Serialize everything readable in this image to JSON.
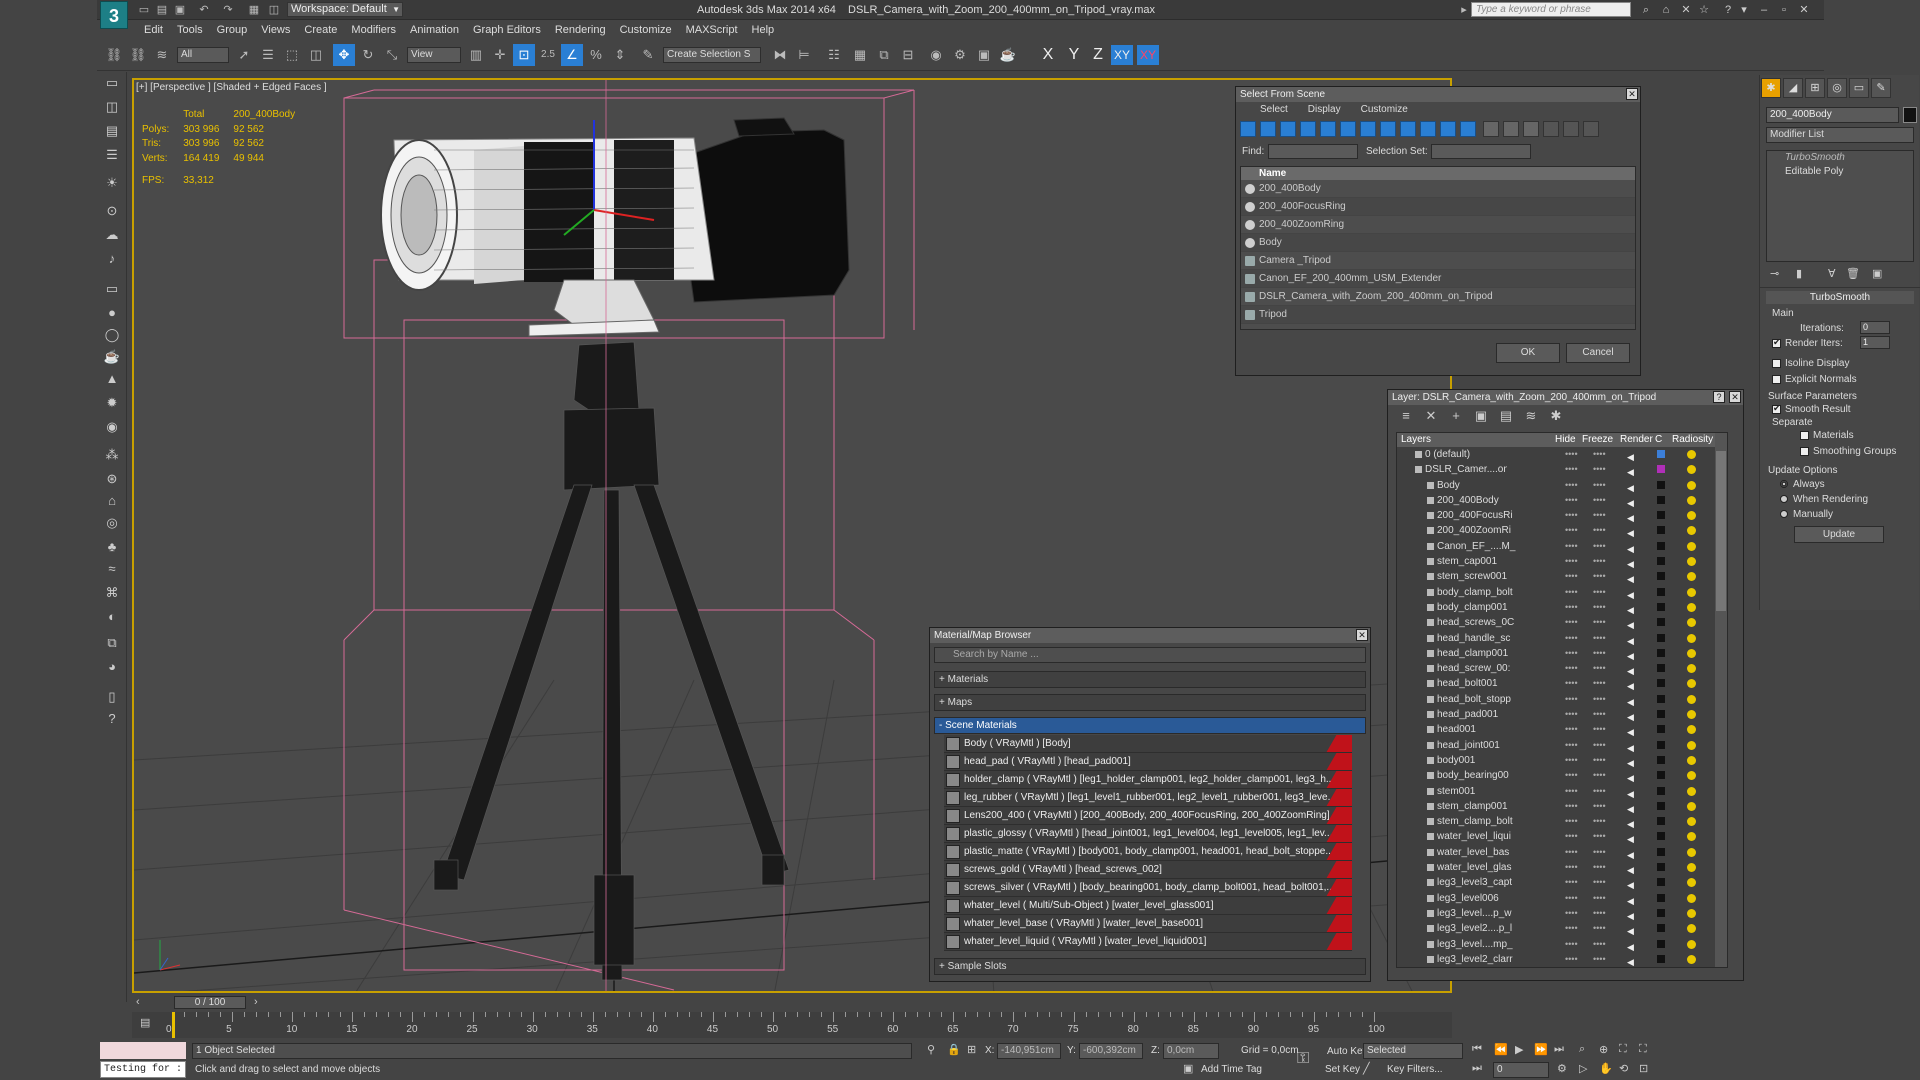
{
  "app": {
    "title": "Autodesk 3ds Max  2014 x64",
    "file": "DSLR_Camera_with_Zoom_200_400mm_on_Tripod_vray.max",
    "workspace": "Workspace: Default",
    "search_placeholder": "Type a keyword or phrase"
  },
  "menu": [
    "Edit",
    "Tools",
    "Group",
    "Views",
    "Create",
    "Modifiers",
    "Animation",
    "Graph Editors",
    "Rendering",
    "Customize",
    "MAXScript",
    "Help"
  ],
  "toolbar": {
    "filter": "All",
    "refcoord": "View",
    "snap_label": "2.5",
    "named_selection": "Create Selection S",
    "axis_x": "X",
    "axis_y": "Y",
    "axis_z": "Z",
    "axis_xy": "XY",
    "axis_xy2": "XY"
  },
  "viewport": {
    "label": "[+] [Perspective ] [Shaded + Edged Faces ]",
    "stats": {
      "total_label": "Total",
      "selected_label": "200_400Body",
      "rows": [
        {
          "label": "Polys:",
          "total": "303 996",
          "sel": "92 562"
        },
        {
          "label": "Tris:",
          "total": "303 996",
          "sel": "92 562"
        },
        {
          "label": "Verts:",
          "total": "164 419",
          "sel": "49 944"
        }
      ],
      "fps_label": "FPS:",
      "fps": "33,312"
    }
  },
  "select_from_scene": {
    "title": "Select From Scene",
    "menu": [
      "Select",
      "Display",
      "Customize"
    ],
    "find_label": "Find:",
    "selection_set_label": "Selection Set:",
    "name_header": "Name",
    "items": [
      {
        "name": "200_400Body",
        "group": false
      },
      {
        "name": "200_400FocusRing",
        "group": false
      },
      {
        "name": "200_400ZoomRing",
        "group": false
      },
      {
        "name": "Body",
        "group": false
      },
      {
        "name": "Camera _Tripod",
        "group": true
      },
      {
        "name": "Canon_EF_200_400mm_USM_Extender",
        "group": true
      },
      {
        "name": "DSLR_Camera_with_Zoom_200_400mm_on_Tripod",
        "group": true
      },
      {
        "name": "Tripod",
        "group": true
      }
    ],
    "ok": "OK",
    "cancel": "Cancel"
  },
  "material_browser": {
    "title": "Material/Map Browser",
    "search": "Search by Name ...",
    "sections": {
      "materials": "+ Materials",
      "maps": "+ Maps",
      "scene": "- Scene Materials",
      "samples": "+ Sample Slots"
    },
    "items": [
      "Body  ( VRayMtl ) [Body]",
      "head_pad  ( VRayMtl ) [head_pad001]",
      "holder_clamp  ( VRayMtl ) [leg1_holder_clamp001, leg2_holder_clamp001, leg3_h...",
      "leg_rubber  ( VRayMtl ) [leg1_level1_rubber001, leg2_level1_rubber001, leg3_leve...",
      "Lens200_400  ( VRayMtl ) [200_400Body, 200_400FocusRing, 200_400ZoomRing]",
      "plastic_glossy  ( VRayMtl ) [head_joint001, leg1_level004, leg1_level005, leg1_lev...",
      "plastic_matte  ( VRayMtl ) [body001, body_clamp001, head001, head_bolt_stoppe...",
      "screws_gold  ( VRayMtl ) [head_screws_002]",
      "screws_silver  ( VRayMtl ) [body_bearing001, body_clamp_bolt001, head_bolt001,...",
      "whater_level  ( Multi/Sub-Object ) [water_level_glass001]",
      "whater_level_base  ( VRayMtl ) [water_level_base001]",
      "whater_level_liquid  ( VRayMtl ) [water_level_liquid001]"
    ]
  },
  "layer_panel": {
    "title": "Layer: DSLR_Camera_with_Zoom_200_400mm_on_Tripod",
    "help": "?",
    "headers": {
      "layers": "Layers",
      "hide": "Hide",
      "freeze": "Freeze",
      "render": "Render",
      "c": "C",
      "radiosity": "Radiosity"
    },
    "rows": [
      {
        "name": "0 (default)",
        "indent": 1,
        "color": "#3c7fd8"
      },
      {
        "name": "DSLR_Camer....on_",
        "indent": 1,
        "color": "#b02fb8"
      },
      {
        "name": "Body",
        "indent": 2,
        "color": "#111111"
      },
      {
        "name": "200_400Body",
        "indent": 2,
        "color": "#111111"
      },
      {
        "name": "200_400FocusRi",
        "indent": 2,
        "color": "#111111"
      },
      {
        "name": "200_400ZoomRi",
        "indent": 2,
        "color": "#111111"
      },
      {
        "name": "Canon_EF_....M_",
        "indent": 2,
        "color": "#111111"
      },
      {
        "name": "stem_cap001",
        "indent": 2,
        "color": "#111111"
      },
      {
        "name": "stem_screw001",
        "indent": 2,
        "color": "#111111"
      },
      {
        "name": "body_clamp_bolt",
        "indent": 2,
        "color": "#111111"
      },
      {
        "name": "body_clamp001",
        "indent": 2,
        "color": "#111111"
      },
      {
        "name": "head_screws_0C",
        "indent": 2,
        "color": "#111111"
      },
      {
        "name": "head_handle_sc",
        "indent": 2,
        "color": "#111111"
      },
      {
        "name": "head_clamp001",
        "indent": 2,
        "color": "#111111"
      },
      {
        "name": "head_screw_00:",
        "indent": 2,
        "color": "#111111"
      },
      {
        "name": "head_bolt001",
        "indent": 2,
        "color": "#111111"
      },
      {
        "name": "head_bolt_stopp",
        "indent": 2,
        "color": "#111111"
      },
      {
        "name": "head_pad001",
        "indent": 2,
        "color": "#111111"
      },
      {
        "name": "head001",
        "indent": 2,
        "color": "#111111"
      },
      {
        "name": "head_joint001",
        "indent": 2,
        "color": "#111111"
      },
      {
        "name": "body001",
        "indent": 2,
        "color": "#111111"
      },
      {
        "name": "body_bearing00",
        "indent": 2,
        "color": "#111111"
      },
      {
        "name": "stem001",
        "indent": 2,
        "color": "#111111"
      },
      {
        "name": "stem_clamp001",
        "indent": 2,
        "color": "#111111"
      },
      {
        "name": "stem_clamp_bolt",
        "indent": 2,
        "color": "#111111"
      },
      {
        "name": "water_level_liqui",
        "indent": 2,
        "color": "#111111"
      },
      {
        "name": "water_level_bas",
        "indent": 2,
        "color": "#111111"
      },
      {
        "name": "water_level_glas",
        "indent": 2,
        "color": "#111111"
      },
      {
        "name": "leg3_level3_capt",
        "indent": 2,
        "color": "#111111"
      },
      {
        "name": "leg3_level006",
        "indent": 2,
        "color": "#111111"
      },
      {
        "name": "leg3_level....p_w",
        "indent": 2,
        "color": "#111111"
      },
      {
        "name": "leg3_level2....p_l",
        "indent": 2,
        "color": "#111111"
      },
      {
        "name": "leg3_level....mp_",
        "indent": 2,
        "color": "#111111"
      },
      {
        "name": "leg3_level2_clarr",
        "indent": 2,
        "color": "#111111"
      }
    ]
  },
  "command_panel": {
    "object_name": "200_400Body",
    "modifier_list": "Modifier List",
    "stack": [
      "TurboSmooth",
      "Editable Poly"
    ],
    "rollout": "TurboSmooth",
    "main": "Main",
    "iterations_label": "Iterations:",
    "iterations": "0",
    "render_iters_label": "Render Iters:",
    "render_iters": "1",
    "isoline": "Isoline Display",
    "explicit": "Explicit Normals",
    "surface": "Surface Parameters",
    "smooth_result": "Smooth Result",
    "separate": "Separate",
    "materials": "Materials",
    "smoothing_groups": "Smoothing Groups",
    "update_options": "Update Options",
    "always": "Always",
    "when_rendering": "When Rendering",
    "manually": "Manually",
    "update": "Update"
  },
  "timeline": {
    "slider": "0 / 100",
    "ticks": [
      0,
      5,
      10,
      15,
      20,
      25,
      30,
      35,
      40,
      45,
      50,
      55,
      60,
      65,
      70,
      75,
      80,
      85,
      90,
      95,
      100
    ]
  },
  "status": {
    "macro": "Testing for :",
    "selected": "1 Object Selected",
    "prompt": "Click and drag to select and move objects",
    "x_label": "X:",
    "x": "-140,951cm",
    "y_label": "Y:",
    "y": "-600,392cm",
    "z_label": "Z:",
    "z": "0,0cm",
    "grid": "Grid = 0,0cm",
    "add_time_tag": "Add Time Tag",
    "autokey": "Auto Key",
    "setkey": "Set Key",
    "selected_dd": "Selected",
    "key_filters": "Key Filters...",
    "frame": "0"
  }
}
